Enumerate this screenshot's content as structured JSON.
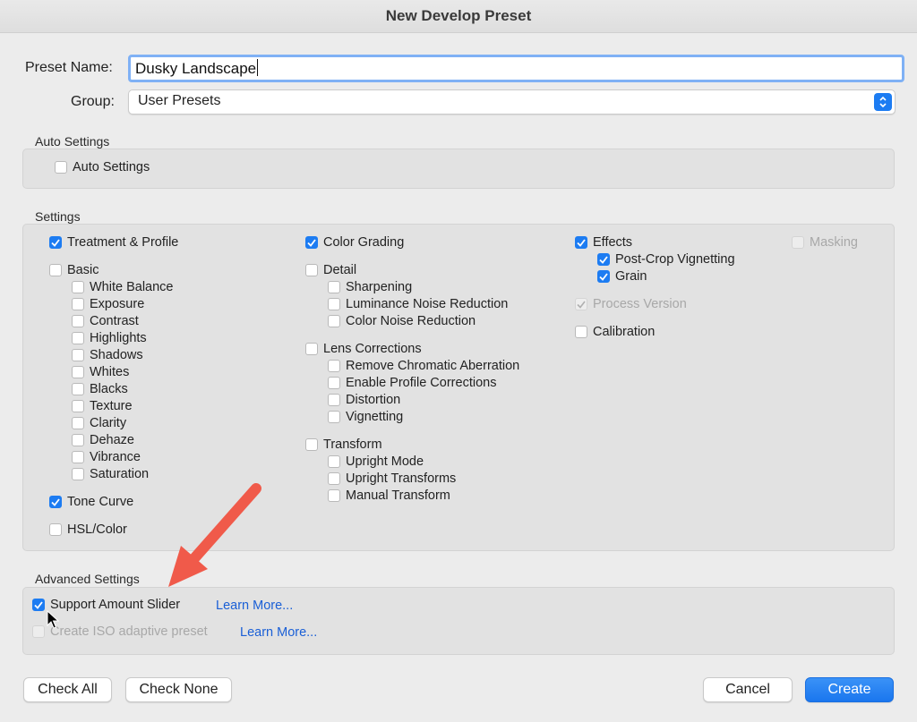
{
  "window": {
    "title": "New Develop Preset"
  },
  "preset_name": {
    "label": "Preset Name:",
    "value": "Dusky Landscape"
  },
  "group": {
    "label": "Group:",
    "value": "User Presets"
  },
  "auto_settings": {
    "title": "Auto Settings",
    "checkbox": {
      "label": "Auto Settings",
      "checked": false
    }
  },
  "settings": {
    "title": "Settings",
    "col1": {
      "treatment": "Treatment & Profile",
      "basic": "Basic",
      "basic_items": [
        "White Balance",
        "Exposure",
        "Contrast",
        "Highlights",
        "Shadows",
        "Whites",
        "Blacks",
        "Texture",
        "Clarity",
        "Dehaze",
        "Vibrance",
        "Saturation"
      ],
      "tone_curve": "Tone Curve",
      "hsl": "HSL/Color"
    },
    "col2": {
      "color_grading": "Color Grading",
      "detail": "Detail",
      "detail_items": [
        "Sharpening",
        "Luminance Noise Reduction",
        "Color Noise Reduction"
      ],
      "lens": "Lens Corrections",
      "lens_items": [
        "Remove Chromatic Aberration",
        "Enable Profile Corrections",
        "Distortion",
        "Vignetting"
      ],
      "transform": "Transform",
      "transform_items": [
        "Upright Mode",
        "Upright Transforms",
        "Manual Transform"
      ]
    },
    "col3": {
      "effects": "Effects",
      "effects_items": [
        "Post-Crop Vignetting",
        "Grain"
      ],
      "process_version": "Process Version",
      "calibration": "Calibration"
    },
    "col4": {
      "masking": "Masking"
    }
  },
  "advanced": {
    "title": "Advanced Settings",
    "support_amount": "Support Amount Slider",
    "iso_adaptive": "Create ISO adaptive preset",
    "learn_more": "Learn More..."
  },
  "buttons": {
    "check_all": "Check All",
    "check_none": "Check None",
    "cancel": "Cancel",
    "create": "Create"
  },
  "colors": {
    "accent": "#1d7cf2",
    "link": "#1a5fd6",
    "annotation_arrow": "#f05a4a"
  }
}
